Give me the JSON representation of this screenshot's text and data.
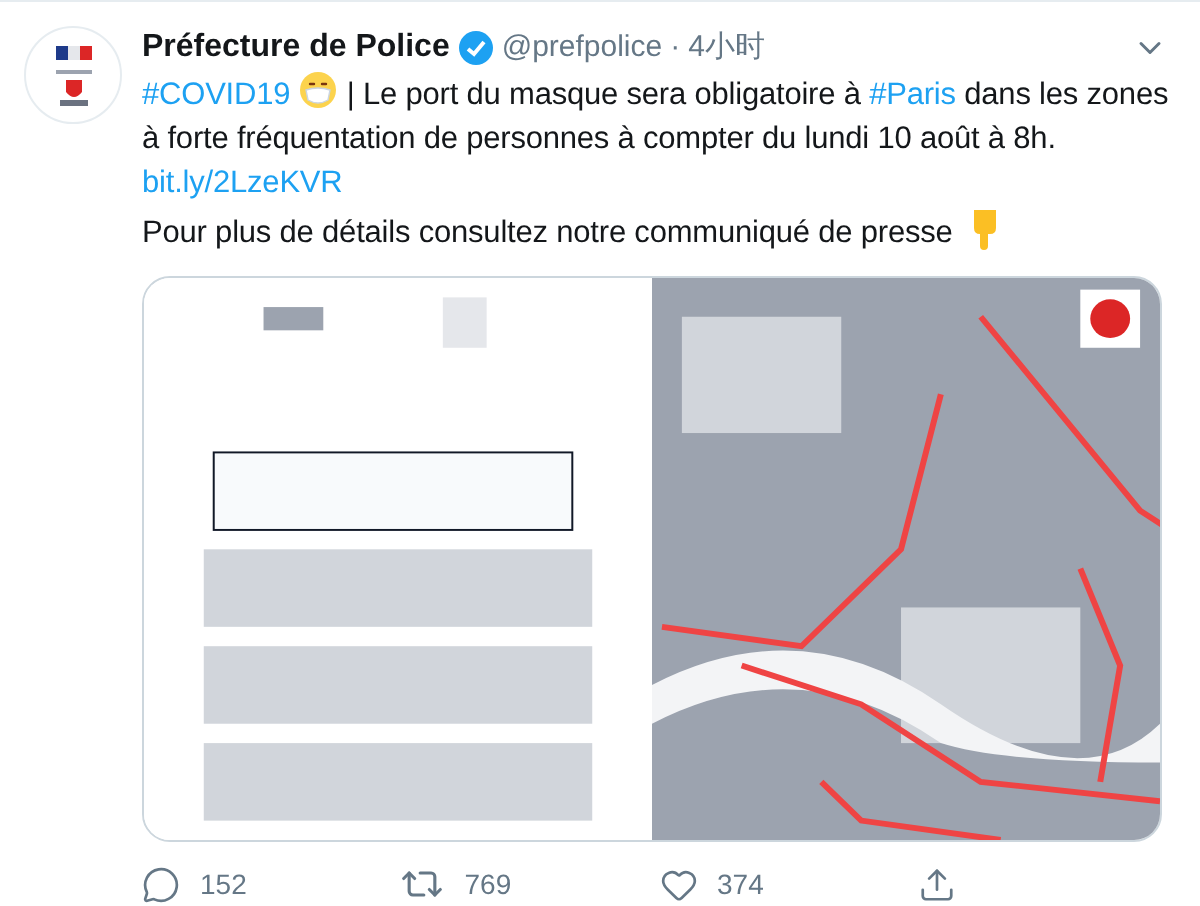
{
  "author": {
    "name": "Préfecture de Police",
    "verified": true,
    "handle": "@prefpolice",
    "separator": "·",
    "time": "4小时"
  },
  "paragraphs": [
    {
      "segments": [
        {
          "kind": "hashtag",
          "text": "#COVID19"
        },
        {
          "kind": "emoji_mask"
        },
        {
          "kind": "text",
          "text": " | Le port du masque sera obligatoire à "
        },
        {
          "kind": "hashtag",
          "text": "#Paris"
        },
        {
          "kind": "text",
          "text": " dans les zones à forte fréquentation de personnes à compter du lundi 10 août à 8h."
        }
      ]
    },
    {
      "segments": [
        {
          "kind": "link",
          "text": "bit.ly/2LzeKVR"
        }
      ]
    },
    {
      "segments": [
        {
          "kind": "text",
          "text": "Pour plus de détails consultez notre communiqué de presse"
        },
        {
          "kind": "emoji_point"
        }
      ]
    }
  ],
  "actions": [
    {
      "kind": "reply",
      "count": "152"
    },
    {
      "kind": "retweet",
      "count": "769"
    },
    {
      "kind": "like",
      "count": "374"
    },
    {
      "kind": "share"
    }
  ]
}
